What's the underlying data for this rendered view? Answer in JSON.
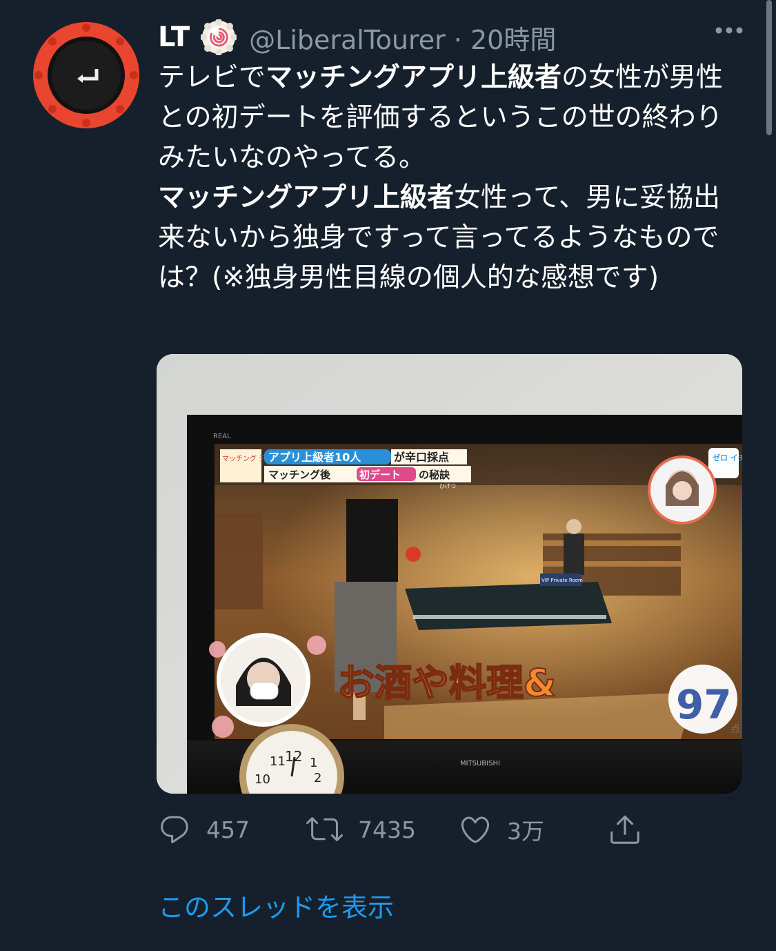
{
  "tweet": {
    "author_name": "LT",
    "handle_time": "@LiberalTourer · 20時間",
    "text": {
      "p1_a": "テレビで",
      "p1_b": "マッチングアプリ上級者",
      "p1_c": "の女性が男性との初デートを評価するというこの世の終わりみたいなのやってる。",
      "p2_a": "マッチングアプリ上級者",
      "p2_b": "女性って、男に妥協出来ないから独身ですって言ってるようなものでは？(※独身男性目線の個人的な感想です)"
    }
  },
  "media": {
    "tv_brand_top": "REAL",
    "tv_brand_bottom": "MITSUBISHI",
    "program_logo": "マッチング テスト",
    "caption_line1_highlight": "アプリ上級者10人",
    "caption_line1_rest": "が辛口採点",
    "caption_line2_a": "マッチング後",
    "caption_line2_highlight": "初デート",
    "caption_line2_b": "の秘訣",
    "caption_ruby": "ひけつ",
    "corner_logo": "ゼロ イチ",
    "overlay_text": "お酒や料理&",
    "score": "97",
    "score_unit": "点",
    "venue_sign": "VIP Private Room"
  },
  "actions": {
    "reply_count": "457",
    "retweet_count": "7435",
    "like_count": "3万"
  },
  "thread_link": "このスレッドを表示",
  "icons": [
    "more-icon",
    "reply-icon",
    "retweet-icon",
    "like-icon",
    "share-icon",
    "avatar-enter-key-icon",
    "verified-like-badge-icon"
  ],
  "colors": {
    "background": "#16202c",
    "secondary_text": "#8b98a5",
    "link": "#1d9bf0"
  }
}
